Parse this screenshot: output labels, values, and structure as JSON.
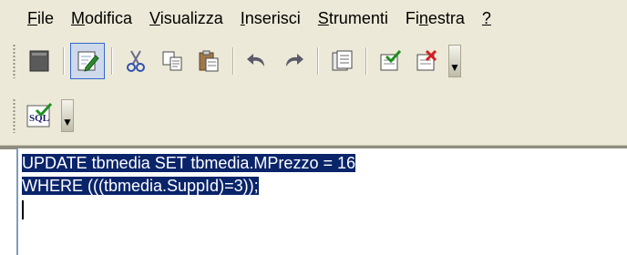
{
  "menu": {
    "items": [
      {
        "mnemonic": "F",
        "rest": "ile"
      },
      {
        "mnemonic": "M",
        "rest": "odifica"
      },
      {
        "mnemonic": "V",
        "rest": "isualizza"
      },
      {
        "mnemonic": "I",
        "rest": "nserisci"
      },
      {
        "mnemonic": "S",
        "rest": "trumenti"
      },
      {
        "pre": "Fi",
        "mnemonic": "n",
        "rest": "estra"
      },
      {
        "mnemonic": "?",
        "rest": ""
      }
    ]
  },
  "toolbar_main": {
    "icons": [
      "view-icon",
      "design-icon",
      "cut-icon",
      "copy-icon",
      "paste-icon",
      "undo-icon",
      "redo-icon",
      "query-properties-icon",
      "check-icon",
      "delete-icon"
    ],
    "pressed": "design-icon"
  },
  "toolbar_sql": {
    "icon": "sql-run-icon",
    "label": "SQL"
  },
  "editor": {
    "lines": [
      "UPDATE tbmedia SET tbmedia.MPrezzo = 16",
      "WHERE (((tbmedia.SuppId)=3));"
    ]
  },
  "colors": {
    "chrome": "#ece9d8",
    "selection": "#0a246a",
    "pressed_border": "#316ac5"
  }
}
